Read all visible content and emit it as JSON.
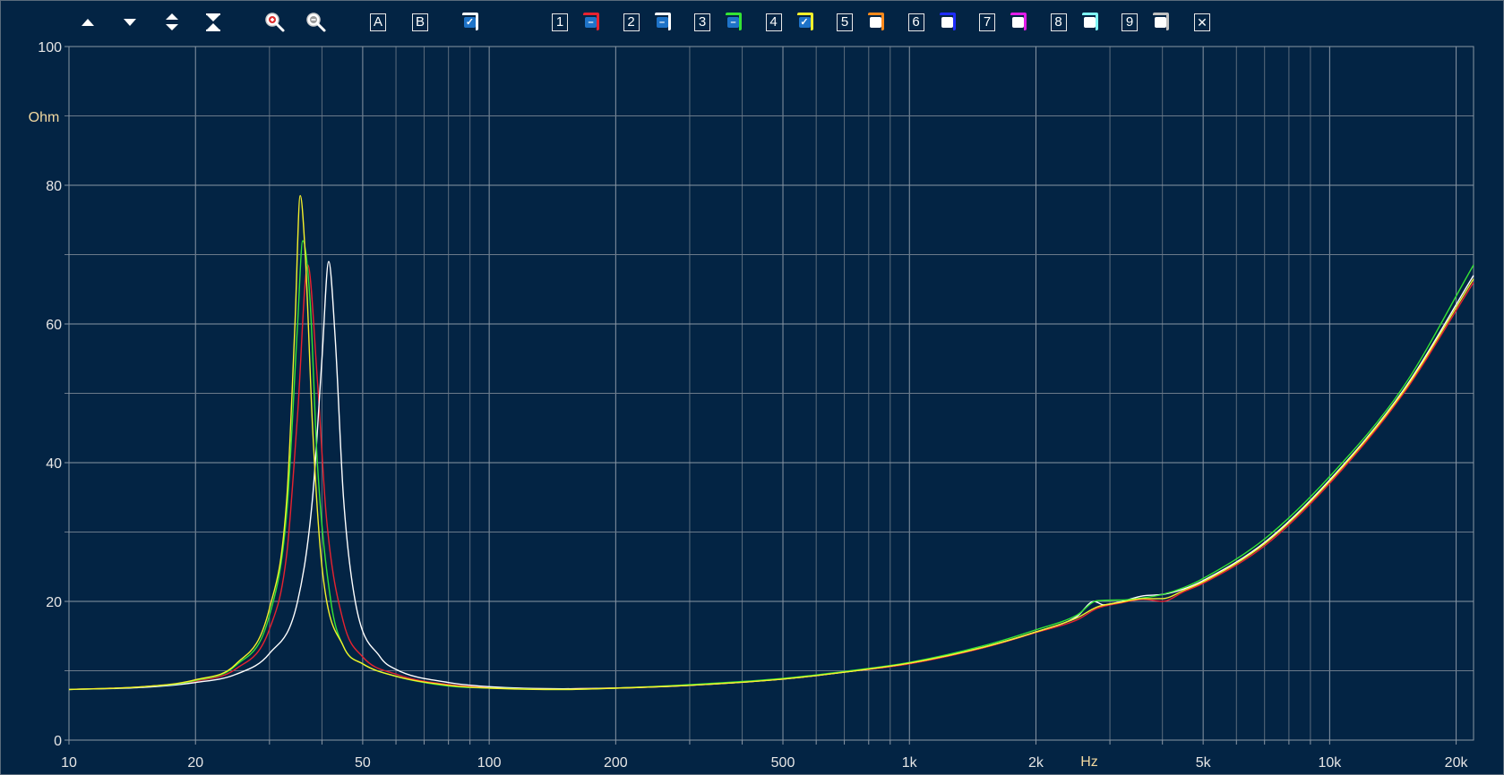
{
  "toolbar": {
    "nav": [
      {
        "name": "move-up-button",
        "icon": "triangle-up-icon"
      },
      {
        "name": "move-down-button",
        "icon": "triangle-down-icon"
      },
      {
        "name": "expand-vertical-button",
        "icon": "expand-arrows-icon"
      },
      {
        "name": "collapse-vertical-button",
        "icon": "collapse-arrows-icon"
      },
      {
        "name": "zoom-in-button",
        "icon": "zoom-in-icon"
      },
      {
        "name": "zoom-out-button",
        "icon": "zoom-out-icon"
      }
    ],
    "label_a": "A",
    "label_b": "B",
    "close_label": "✕",
    "slots": [
      {
        "label": "1",
        "color": "#e8222f",
        "inner": "#1e73c8",
        "mark": "–"
      },
      {
        "label": "2",
        "color": "#ffffff",
        "inner": "#1e73c8",
        "mark": "–"
      },
      {
        "label": "3",
        "color": "#34e334",
        "inner": "#1e73c8",
        "mark": "–"
      },
      {
        "label": "4",
        "color": "#f5f02a",
        "inner": "#1e73c8",
        "mark": "✓"
      },
      {
        "label": "5",
        "color": "#ff8a1c",
        "inner": "#ffffff",
        "mark": ""
      },
      {
        "label": "6",
        "color": "#1e2cff",
        "inner": "#ffffff",
        "mark": ""
      },
      {
        "label": "7",
        "color": "#e21ce8",
        "inner": "#ffffff",
        "mark": ""
      },
      {
        "label": "8",
        "color": "#7ff5f5",
        "inner": "#ffffff",
        "mark": ""
      },
      {
        "label": "9",
        "color": "#c0c0c0",
        "inner": "#ffffff",
        "mark": ""
      }
    ]
  },
  "chart_data": {
    "type": "line",
    "title": "",
    "xlabel": "Hz",
    "ylabel": "Ohm",
    "xscale": "log",
    "xlim": [
      10,
      22000
    ],
    "ylim": [
      0,
      100
    ],
    "grid": true,
    "x_ticks": [
      {
        "value": 10,
        "label": "10"
      },
      {
        "value": 20,
        "label": "20"
      },
      {
        "value": 50,
        "label": "50"
      },
      {
        "value": 100,
        "label": "100"
      },
      {
        "value": 200,
        "label": "200"
      },
      {
        "value": 500,
        "label": "500"
      },
      {
        "value": 1000,
        "label": "1k"
      },
      {
        "value": 2000,
        "label": "2k"
      },
      {
        "value": 5000,
        "label": "5k"
      },
      {
        "value": 10000,
        "label": "10k"
      },
      {
        "value": 20000,
        "label": "20k"
      }
    ],
    "y_ticks": [
      {
        "value": 0,
        "label": "0"
      },
      {
        "value": 20,
        "label": "20"
      },
      {
        "value": 40,
        "label": "40"
      },
      {
        "value": 60,
        "label": "60"
      },
      {
        "value": 80,
        "label": "80"
      },
      {
        "value": 100,
        "label": "100"
      }
    ],
    "series": [
      {
        "color": "#e8222f",
        "points": [
          [
            10,
            7.3
          ],
          [
            15,
            7.7
          ],
          [
            20,
            8.5
          ],
          [
            25,
            10.3
          ],
          [
            30,
            16
          ],
          [
            33,
            27
          ],
          [
            35,
            47
          ],
          [
            37,
            68.5
          ],
          [
            39,
            52
          ],
          [
            41,
            32
          ],
          [
            45,
            17
          ],
          [
            50,
            12
          ],
          [
            60,
            9.5
          ],
          [
            80,
            8
          ],
          [
            100,
            7.6
          ],
          [
            150,
            7.4
          ],
          [
            200,
            7.5
          ],
          [
            300,
            7.9
          ],
          [
            500,
            8.8
          ],
          [
            700,
            9.8
          ],
          [
            1000,
            11
          ],
          [
            1500,
            13.3
          ],
          [
            2000,
            15.5
          ],
          [
            2500,
            17.3
          ],
          [
            2800,
            19
          ],
          [
            3200,
            19.8
          ],
          [
            3600,
            20.3
          ],
          [
            4000,
            20
          ],
          [
            4500,
            21.4
          ],
          [
            5000,
            22.6
          ],
          [
            7000,
            28
          ],
          [
            10000,
            37
          ],
          [
            15000,
            50
          ],
          [
            22000,
            66
          ]
        ]
      },
      {
        "color": "#ffffff",
        "points": [
          [
            10,
            7.3
          ],
          [
            15,
            7.6
          ],
          [
            20,
            8.3
          ],
          [
            25,
            9.5
          ],
          [
            30,
            12.5
          ],
          [
            35,
            20
          ],
          [
            38,
            35
          ],
          [
            40,
            55
          ],
          [
            41.5,
            69
          ],
          [
            43,
            58
          ],
          [
            45,
            35
          ],
          [
            48,
            20
          ],
          [
            55,
            12
          ],
          [
            60,
            10.2
          ],
          [
            80,
            8.3
          ],
          [
            100,
            7.7
          ],
          [
            150,
            7.4
          ],
          [
            200,
            7.5
          ],
          [
            300,
            7.9
          ],
          [
            500,
            8.8
          ],
          [
            700,
            9.8
          ],
          [
            1000,
            11.1
          ],
          [
            1500,
            13.4
          ],
          [
            2000,
            15.6
          ],
          [
            2500,
            17.8
          ],
          [
            2750,
            20
          ],
          [
            2900,
            19.5
          ],
          [
            3200,
            20
          ],
          [
            3600,
            20.8
          ],
          [
            4000,
            21
          ],
          [
            4500,
            21.8
          ],
          [
            5000,
            23
          ],
          [
            7000,
            28.5
          ],
          [
            10000,
            37.5
          ],
          [
            15000,
            50.5
          ],
          [
            22000,
            67
          ]
        ]
      },
      {
        "color": "#34e334",
        "points": [
          [
            10,
            7.3
          ],
          [
            15,
            7.7
          ],
          [
            20,
            8.6
          ],
          [
            25,
            10.8
          ],
          [
            30,
            18
          ],
          [
            33,
            33
          ],
          [
            35,
            60
          ],
          [
            36,
            72
          ],
          [
            37.5,
            63
          ],
          [
            39,
            40
          ],
          [
            42,
            20
          ],
          [
            45,
            13.5
          ],
          [
            50,
            11
          ],
          [
            60,
            9.2
          ],
          [
            80,
            7.8
          ],
          [
            100,
            7.5
          ],
          [
            150,
            7.3
          ],
          [
            200,
            7.5
          ],
          [
            300,
            8
          ],
          [
            500,
            8.9
          ],
          [
            700,
            9.9
          ],
          [
            1000,
            11.2
          ],
          [
            1500,
            13.6
          ],
          [
            2000,
            15.9
          ],
          [
            2500,
            18
          ],
          [
            2800,
            20.1
          ],
          [
            3200,
            20.2
          ],
          [
            3600,
            20.5
          ],
          [
            4000,
            21
          ],
          [
            4500,
            22
          ],
          [
            5000,
            23.3
          ],
          [
            7000,
            29
          ],
          [
            10000,
            38
          ],
          [
            15000,
            51
          ],
          [
            22000,
            68.5
          ]
        ]
      },
      {
        "color": "#f5f02a",
        "points": [
          [
            10,
            7.3
          ],
          [
            15,
            7.7
          ],
          [
            20,
            8.7
          ],
          [
            25,
            11
          ],
          [
            30,
            19
          ],
          [
            33,
            35
          ],
          [
            34.5,
            60
          ],
          [
            35.5,
            78.5
          ],
          [
            36.5,
            70
          ],
          [
            38,
            45
          ],
          [
            40,
            25
          ],
          [
            45,
            13.5
          ],
          [
            50,
            11
          ],
          [
            60,
            9.2
          ],
          [
            80,
            7.9
          ],
          [
            100,
            7.5
          ],
          [
            150,
            7.3
          ],
          [
            200,
            7.5
          ],
          [
            300,
            7.9
          ],
          [
            500,
            8.8
          ],
          [
            700,
            9.8
          ],
          [
            1000,
            11.1
          ],
          [
            1500,
            13.4
          ],
          [
            2000,
            15.6
          ],
          [
            2500,
            17.6
          ],
          [
            2800,
            19.2
          ],
          [
            3200,
            19.9
          ],
          [
            3600,
            20.4
          ],
          [
            4000,
            20.4
          ],
          [
            4500,
            21.6
          ],
          [
            5000,
            22.8
          ],
          [
            7000,
            28.3
          ],
          [
            10000,
            37.3
          ],
          [
            15000,
            50.3
          ],
          [
            22000,
            66.5
          ]
        ]
      }
    ]
  }
}
